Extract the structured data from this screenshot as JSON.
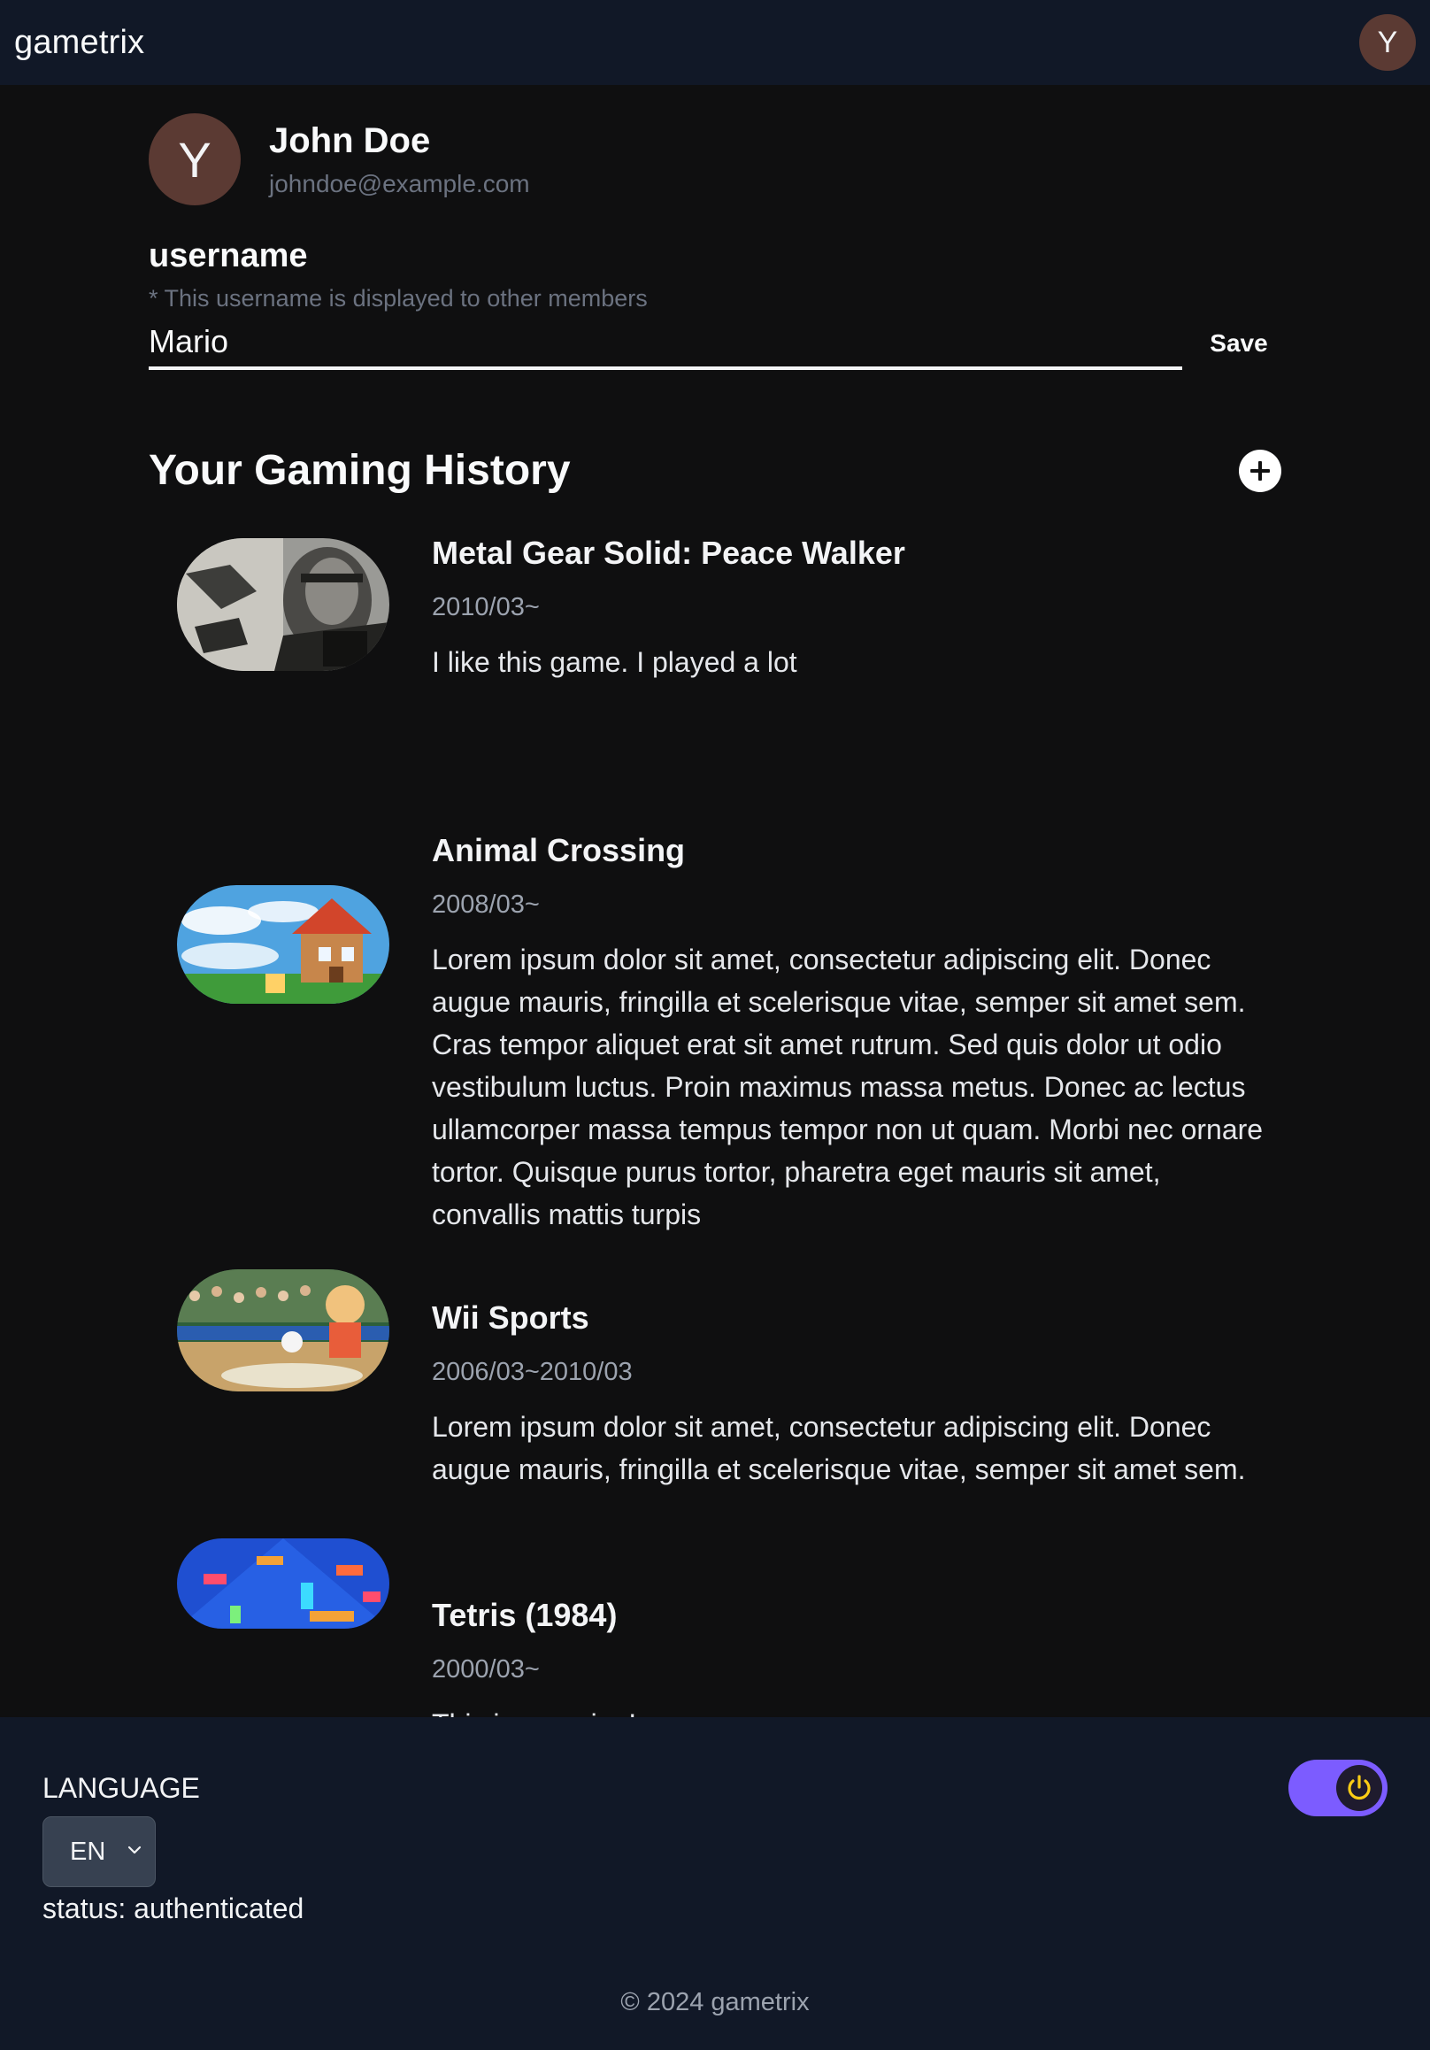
{
  "header": {
    "brand": "gametrix",
    "avatar_initial": "Y"
  },
  "profile": {
    "avatar_initial": "Y",
    "name": "John Doe",
    "email": "johndoe@example.com"
  },
  "username": {
    "label": "username",
    "hint": "* This username is displayed to other members",
    "value": "Mario",
    "save_label": "Save"
  },
  "history": {
    "title": "Your Gaming History",
    "add_icon": "plus-circle-icon",
    "games": [
      {
        "title": "Metal Gear Solid: Peace Walker",
        "date": "2010/03~",
        "description": "I like this game. I played a lot"
      },
      {
        "title": "Animal Crossing",
        "date": "2008/03~",
        "description": "Lorem ipsum dolor sit amet, consectetur adipiscing elit. Donec augue mauris, fringilla et scelerisque vitae, semper sit amet sem. Cras tempor aliquet erat sit amet rutrum. Sed quis dolor ut odio vestibulum luctus. Proin maximus massa metus. Donec ac lectus ullamcorper massa tempus tempor non ut quam. Morbi nec ornare tortor. Quisque purus tortor, pharetra eget mauris sit amet, convallis mattis turpis"
      },
      {
        "title": "Wii Sports",
        "date": "2006/03~2010/03",
        "description": "Lorem ipsum dolor sit amet, consectetur adipiscing elit. Donec augue mauris, fringilla et scelerisque vitae, semper sit amet sem."
      },
      {
        "title": "Tetris (1984)",
        "date": "2000/03~",
        "description": "This is amazing!"
      }
    ]
  },
  "footer": {
    "language_label": "LANGUAGE",
    "language_value": "EN",
    "status": "status: authenticated",
    "toggle_icon": "power-icon",
    "copyright": "© 2024 gametrix"
  },
  "colors": {
    "header_bg": "#111827",
    "main_bg": "#0f0f10",
    "avatar_bg": "#5b3a33",
    "toggle_accent": "#7c5cff",
    "power_icon": "#facc15"
  }
}
